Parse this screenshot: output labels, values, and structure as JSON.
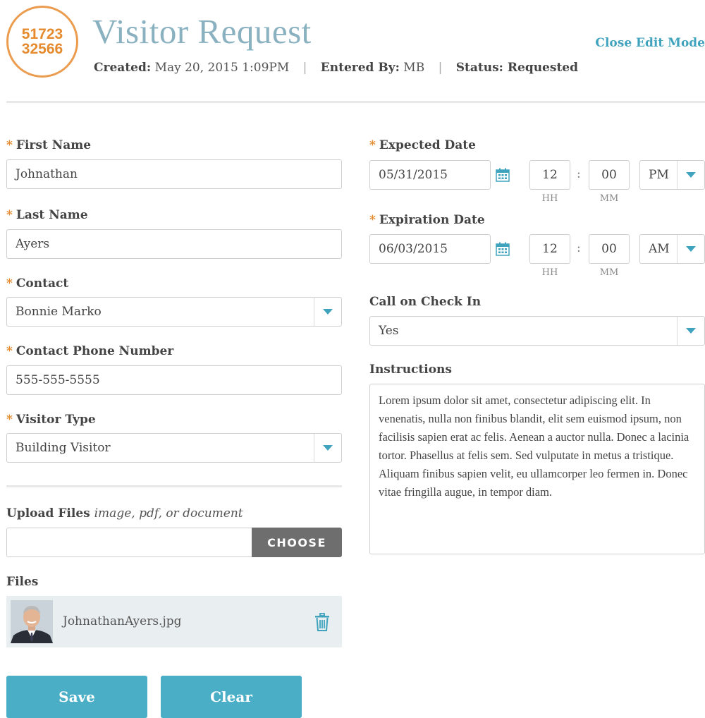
{
  "header": {
    "badge_line1": "51723",
    "badge_line2": "32566",
    "title": "Visitor Request",
    "created_label": "Created:",
    "created_value": "May 20, 2015 1:09PM",
    "entered_label": "Entered By:",
    "entered_value": "MB",
    "status_label": "Status: Requested",
    "separator": "|",
    "close_edit": "Close Edit Mode"
  },
  "form": {
    "required_marker": "*",
    "first_name": {
      "label": "First Name",
      "value": "Johnathan"
    },
    "last_name": {
      "label": "Last Name",
      "value": "Ayers"
    },
    "contact": {
      "label": "Contact",
      "value": "Bonnie Marko"
    },
    "contact_phone": {
      "label": "Contact Phone Number",
      "value": "555-555-5555"
    },
    "visitor_type": {
      "label": "Visitor Type",
      "value": "Building Visitor"
    },
    "expected": {
      "label": "Expected Date",
      "date": "05/31/2015",
      "hh": "12",
      "mm": "00",
      "ampm": "PM"
    },
    "expiration": {
      "label": "Expiration Date",
      "date": "06/03/2015",
      "hh": "12",
      "mm": "00",
      "ampm": "AM"
    },
    "hh_label": "HH",
    "mm_label": "MM",
    "colon": ":",
    "call_on_checkin": {
      "label": "Call on Check In",
      "value": "Yes"
    },
    "instructions": {
      "label": "Instructions",
      "value": "Lorem ipsum dolor sit amet, consectetur adipiscing elit. In venenatis, nulla non finibus blandit, elit sem euismod ipsum, non facilisis sapien erat ac felis. Aenean a auctor nulla. Donec a lacinia tortor. Phasellus at felis sem. Sed vulputate in metus a tristique. Aliquam finibus sapien velit, eu ullamcorper leo fermen in. Donec vitae fringilla augue, in tempor diam."
    },
    "upload": {
      "label": "Upload Files",
      "hint": "image, pdf, or document",
      "button": "CHOOSE"
    },
    "files": {
      "label": "Files",
      "items": [
        {
          "name": "JohnathanAyers.jpg"
        }
      ]
    }
  },
  "actions": {
    "save": "Save",
    "clear": "Clear"
  },
  "colors": {
    "accent": "#4aaec6",
    "link": "#3fa3bd",
    "badge": "#e68a2e",
    "title": "#8ab1c0"
  },
  "icons": [
    "calendar-icon",
    "chevron-down-icon",
    "trash-icon",
    "avatar-photo"
  ]
}
